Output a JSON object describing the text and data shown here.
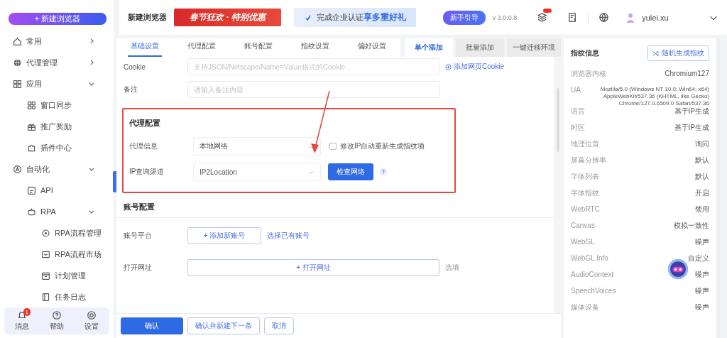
{
  "sidebar": {
    "new_button": "+ 新建浏览器",
    "items": [
      {
        "label": "常用",
        "expanded": false
      },
      {
        "label": "代理管理",
        "expanded": false
      },
      {
        "label": "应用",
        "expanded": true,
        "children": [
          {
            "label": "窗口同步"
          },
          {
            "label": "推广奖励"
          },
          {
            "label": "插件中心"
          }
        ]
      },
      {
        "label": "自动化",
        "expanded": true,
        "children": [
          {
            "label": "API"
          },
          {
            "label": "RPA",
            "expanded": true,
            "children": [
              {
                "label": "RPA流程管理"
              },
              {
                "label": "RPA流程市场"
              },
              {
                "label": "计划管理"
              },
              {
                "label": "任务日志"
              }
            ]
          }
        ]
      }
    ],
    "bottom": [
      {
        "label": "消息",
        "badge": "1"
      },
      {
        "label": "帮助"
      },
      {
        "label": "设置"
      }
    ]
  },
  "topbar": {
    "title": "新建浏览器",
    "promo_banner": "春节狂欢 · 特别优惠",
    "cert_banner": "完成企业认证**享多重好礼**",
    "guide_badge": "新手引导",
    "version": "v 3.0.0.8",
    "user": "yulei.xu"
  },
  "form": {
    "tabs": [
      {
        "label": "基础设置",
        "selected": true
      },
      {
        "label": "代理配置",
        "selected": false
      },
      {
        "label": "账号配置",
        "selected": false
      },
      {
        "label": "指纹设置",
        "selected": false
      },
      {
        "label": "偏好设置",
        "selected": false
      }
    ],
    "mode_tabs": [
      {
        "label": "单个添加",
        "selected": true
      },
      {
        "label": "批量添加",
        "selected": false
      },
      {
        "label": "一键迁移环境",
        "selected": false
      }
    ],
    "cookie": {
      "label": "Cookie",
      "placeholder": "支持JSON/Netscape/Name=Value格式的Cookie",
      "link": "添加网页Cookie"
    },
    "remark": {
      "label": "备注",
      "placeholder": "请输入备注内容"
    },
    "proxy": {
      "title": "代理配置",
      "proxy_label": "代理信息",
      "proxy_value": "本地网络",
      "regen_checkbox": {
        "label": "修改IP自动重新生成指纹项",
        "checked": false
      },
      "ip_label": "IP查询渠道",
      "ip_value": "IP2Location",
      "check_button": "检查网络"
    },
    "account": {
      "title": "账号配置",
      "platform_label": "账号平台",
      "add_button": "+ 添加新账号",
      "select_link": "选择已有账号",
      "url_label": "打开网址",
      "url_button": "+ 打开网址",
      "optional": "选填"
    },
    "footer": [
      "确认",
      "确认并新建下一条",
      "取消"
    ]
  },
  "fingerprint": {
    "title": "指纹信息",
    "random_button": "随机生成指纹",
    "rows": [
      {
        "label": "浏览器内核",
        "value": "Chromium127"
      },
      {
        "label": "UA",
        "value": "Mozilla/5.0 (Windows NT 10.0; Win64; x64) AppleWebKit/537.36 (KHTML, like Gecko) Chrome/127.0.6509.0 Safari/537.36"
      },
      {
        "label": "语言",
        "value": "基于IP生成"
      },
      {
        "label": "时区",
        "value": "基于IP生成"
      },
      {
        "label": "地理位置",
        "value": "询问"
      },
      {
        "label": "屏幕分辨率",
        "value": "默认"
      },
      {
        "label": "字体列表",
        "value": "默认"
      },
      {
        "label": "字体指纹",
        "value": "开启"
      },
      {
        "label": "WebRTC",
        "value": "禁用"
      },
      {
        "label": "Canvas",
        "value": "模拟一致性"
      },
      {
        "label": "WebGL",
        "value": "噪声"
      },
      {
        "label": "WebGL Info",
        "value": "自定义"
      },
      {
        "label": "AudioContext",
        "value": "噪声"
      },
      {
        "label": "SpeechVoices",
        "value": "噪声"
      },
      {
        "label": "媒体设备",
        "value": "噪声"
      }
    ]
  }
}
